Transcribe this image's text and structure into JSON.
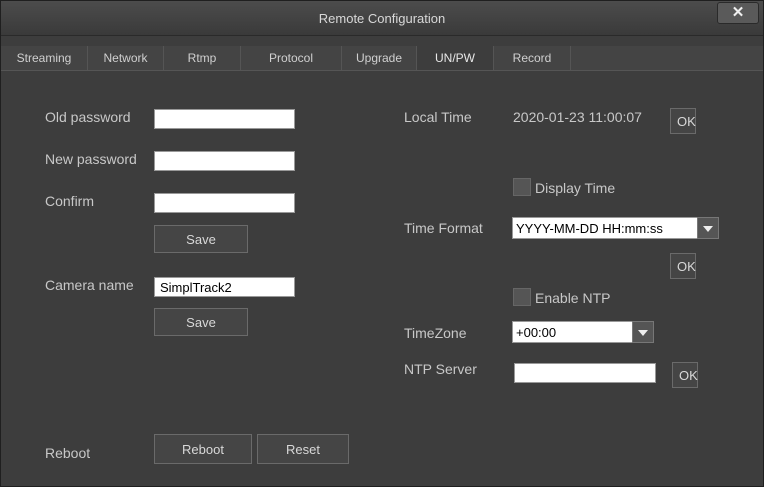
{
  "window": {
    "title": "Remote Configuration",
    "close_glyph": "✕"
  },
  "tabs": [
    {
      "label": "Streaming"
    },
    {
      "label": "Network"
    },
    {
      "label": "Rtmp"
    },
    {
      "label": "Protocol"
    },
    {
      "label": "Upgrade"
    },
    {
      "label": "UN/PW",
      "active": true
    },
    {
      "label": "Record"
    }
  ],
  "password": {
    "old_label": "Old password",
    "new_label": "New password",
    "confirm_label": "Confirm",
    "old_value": "",
    "new_value": "",
    "confirm_value": "",
    "save_label": "Save"
  },
  "camera": {
    "name_label": "Camera name",
    "name_value": "SimplTrack2",
    "save_label": "Save"
  },
  "reboot": {
    "label": "Reboot",
    "reboot_button": "Reboot",
    "reset_button": "Reset"
  },
  "time": {
    "local_time_label": "Local Time",
    "local_time_value": "2020-01-23 11:00:07",
    "ok_label": "OK",
    "display_time_label": "Display Time",
    "display_time_checked": false,
    "format_label": "Time Format",
    "format_value": "YYYY-MM-DD HH:mm:ss",
    "format_ok_label": "OK",
    "enable_ntp_label": "Enable NTP",
    "enable_ntp_checked": false,
    "timezone_label": "TimeZone",
    "timezone_value": "+00:00",
    "ntp_server_label": "NTP Server",
    "ntp_server_value": "",
    "ntp_ok_label": "OK"
  },
  "colors": {
    "background": "#3d3d3d",
    "text": "#c8c8c8",
    "input": "#ffffff"
  }
}
